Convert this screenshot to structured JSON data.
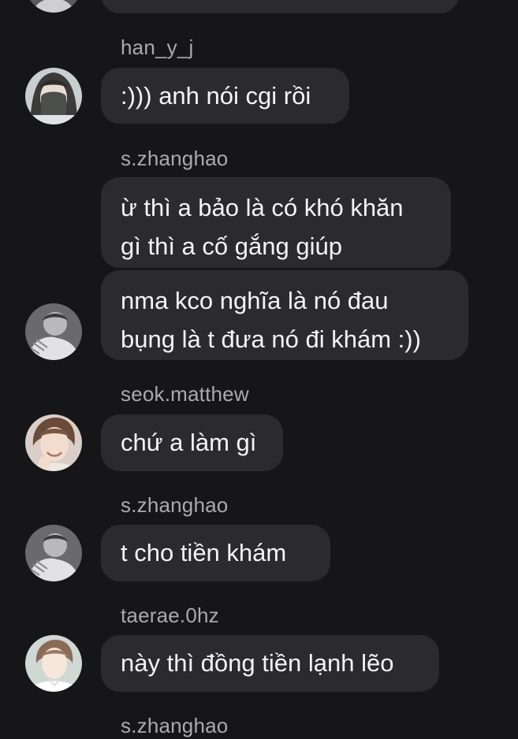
{
  "messages": [
    {
      "username": "han_y_j",
      "text": ":))) anh nói cgi rồi",
      "avatar": "masked-person-avatar"
    },
    {
      "username": "s.zhanghao",
      "text_lines": [
        "ừ thì a bảo là có khó khăn",
        "gì thì a cố gắng giúp"
      ]
    },
    {
      "text_lines": [
        "nma kco nghĩa là nó đau",
        "bụng là t đưa nó đi khám :))"
      ],
      "avatar": "grayscale-person-avatar"
    },
    {
      "username": "seok.matthew",
      "text": "chứ a làm gì",
      "avatar": "smiling-person-avatar"
    },
    {
      "username": "s.zhanghao",
      "text": "t cho tiền khám",
      "avatar": "grayscale-person-avatar"
    },
    {
      "username": "taerae.0hz",
      "text": "này thì đồng tiền lạnh lẽo",
      "avatar": "white-shirt-person-avatar"
    },
    {
      "username": "s.zhanghao"
    }
  ],
  "colors": {
    "background": "#161619",
    "bubble": "#2b2b2f",
    "username": "#a9a9b1",
    "text": "#f4f4f6"
  }
}
